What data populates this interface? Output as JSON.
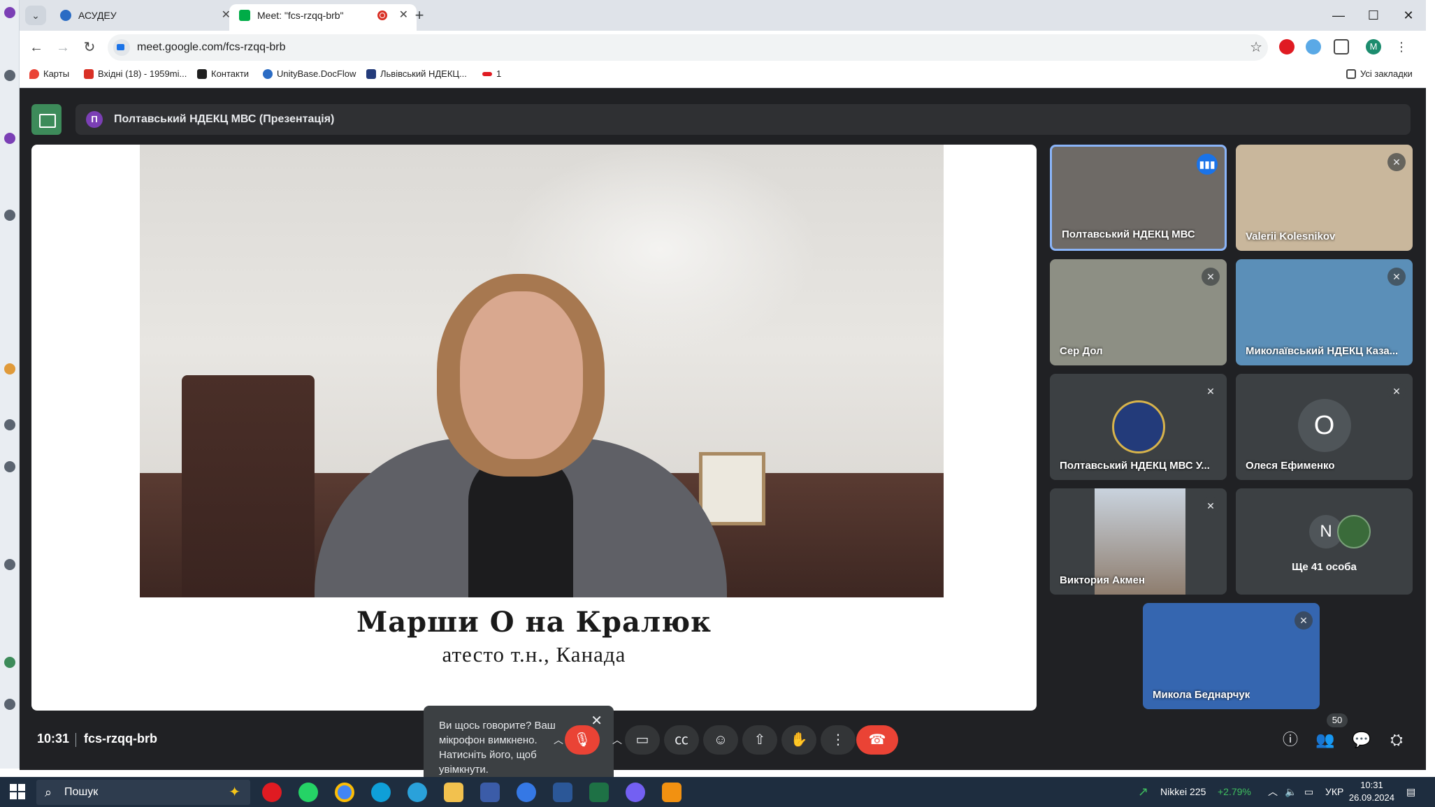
{
  "browser": {
    "tabs": [
      {
        "label": "АСУДЕУ"
      },
      {
        "label": "Meet: \"fcs-rzqq-brb\""
      }
    ],
    "url": "meet.google.com/fcs-rzqq-brb",
    "bookmarks": [
      {
        "label": "Карты"
      },
      {
        "label": "Вхідні (18) - 1959mi..."
      },
      {
        "label": "Контакти"
      },
      {
        "label": "UnityBase.DocFlow"
      },
      {
        "label": "Львівський НДЕКЦ..."
      },
      {
        "label": "1"
      }
    ],
    "all_bookmarks": "Усі закладки"
  },
  "meet": {
    "presenter_initial": "П",
    "presenter_title": "Полтавський НДЕКЦ МВС (Презентація)",
    "caption_name": "Марши    О                    на Кралюк",
    "caption_sub": "атесто                             т.н., Канада",
    "tooltip": "Ви щось говорите? Ваш мікрофон вимкнено. Натисніть його, щоб увімкнути.",
    "participants": [
      {
        "name": "Полтавський НДЕКЦ МВС",
        "state": "speaking"
      },
      {
        "name": "Valerii Kolesnikov",
        "state": "muted"
      },
      {
        "name": "Сер Дол",
        "state": "muted"
      },
      {
        "name": "Миколаївський НДЕКЦ Каза...",
        "state": "muted"
      },
      {
        "name": "Полтавський НДЕКЦ МВС У...",
        "state": "muted"
      },
      {
        "name": "Олеся Ефименко",
        "initial": "О",
        "state": "muted"
      },
      {
        "name": "Виктория Акмен",
        "state": "muted"
      },
      {
        "name": "Ще 41 особа",
        "initial": "N"
      },
      {
        "name": "Микола Беднарчук",
        "state": "muted"
      }
    ],
    "time": "10:31",
    "meeting_code": "fcs-rzqq-brb",
    "participant_count": "50"
  },
  "taskbar": {
    "search": "Пошук",
    "market_name": "Nikkei 225",
    "market_change": "+2.79%",
    "language": "УКР",
    "time": "10:31",
    "date": "26.09.2024"
  },
  "colors": {
    "meet_bg": "#202124",
    "mic_off": "#ea4335",
    "speaking_border": "#8ab4f8",
    "market_up": "#3fbf5f"
  }
}
